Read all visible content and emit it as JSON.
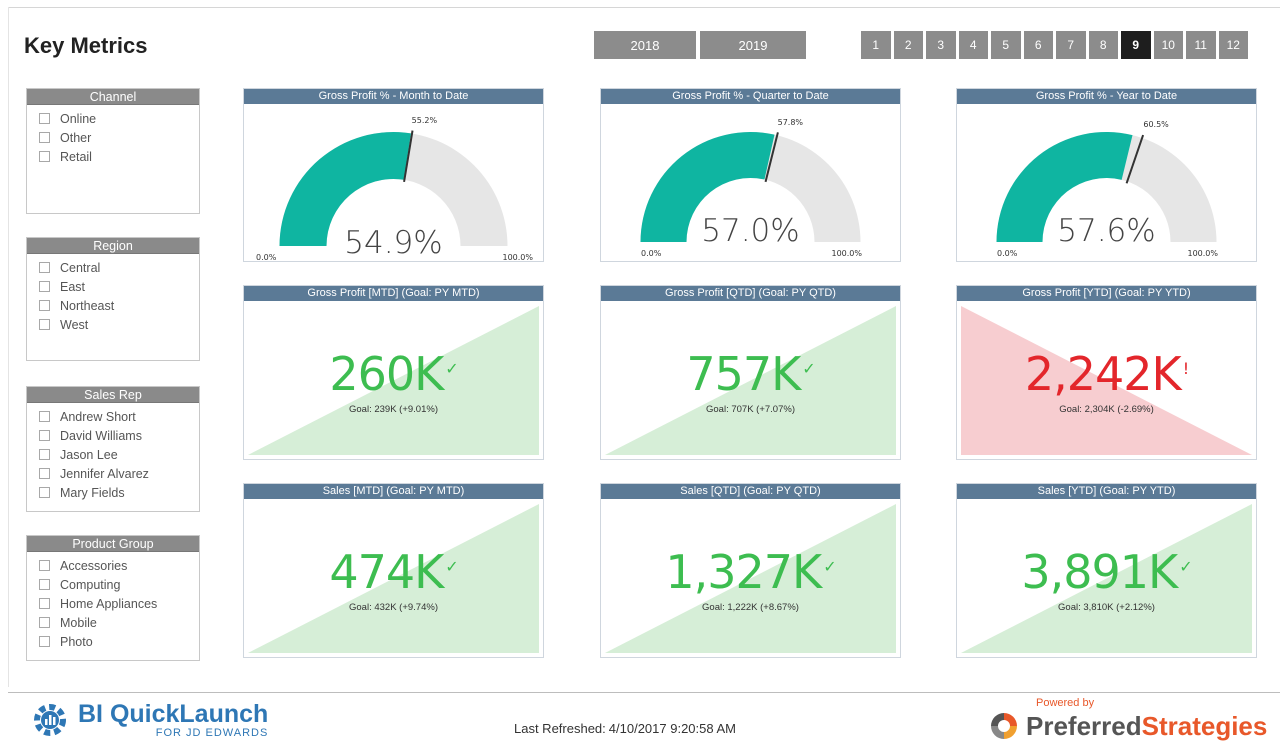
{
  "page_title": "Key Metrics",
  "years": [
    "2018",
    "2019"
  ],
  "months": [
    "1",
    "2",
    "3",
    "4",
    "5",
    "6",
    "7",
    "8",
    "9",
    "10",
    "11",
    "12"
  ],
  "selected_month": "9",
  "slicers": {
    "channel": {
      "title": "Channel",
      "items": [
        "Online",
        "Other",
        "Retail"
      ]
    },
    "region": {
      "title": "Region",
      "items": [
        "Central",
        "East",
        "Northeast",
        "West"
      ]
    },
    "sales_rep": {
      "title": "Sales Rep",
      "items": [
        "Andrew Short",
        "David Williams",
        "Jason Lee",
        "Jennifer Alvarez",
        "Mary Fields"
      ]
    },
    "product_group": {
      "title": "Product Group",
      "items": [
        "Accessories",
        "Computing",
        "Home Appliances",
        "Mobile",
        "Photo"
      ]
    }
  },
  "gauges": [
    {
      "title": "Gross Profit % - Month to Date",
      "value": "54.9%",
      "value_pct": 54.9,
      "target": "55.2%",
      "target_pct": 55.2,
      "min": "0.0%",
      "max": "100.0%"
    },
    {
      "title": "Gross Profit % - Quarter to Date",
      "value": "57.0%",
      "value_pct": 57.0,
      "target": "57.8%",
      "target_pct": 57.8,
      "min": "0.0%",
      "max": "100.0%"
    },
    {
      "title": "Gross Profit % - Year to Date",
      "value": "57.6%",
      "value_pct": 57.6,
      "target": "60.5%",
      "target_pct": 60.5,
      "min": "0.0%",
      "max": "100.0%"
    }
  ],
  "kpis": [
    {
      "title": "Gross Profit [MTD] (Goal: PY MTD)",
      "value": "260K",
      "goal": "Goal: 239K (+9.01%)",
      "status": "good",
      "indicator": "✓"
    },
    {
      "title": "Gross Profit [QTD] (Goal: PY QTD)",
      "value": "757K",
      "goal": "Goal: 707K (+7.07%)",
      "status": "good",
      "indicator": "✓"
    },
    {
      "title": "Gross Profit [YTD] (Goal: PY YTD)",
      "value": "2,242K",
      "goal": "Goal: 2,304K (-2.69%)",
      "status": "bad",
      "indicator": "!"
    },
    {
      "title": "Sales [MTD] (Goal: PY MTD)",
      "value": "474K",
      "goal": "Goal: 432K (+9.74%)",
      "status": "good",
      "indicator": "✓"
    },
    {
      "title": "Sales [QTD] (Goal: PY QTD)",
      "value": "1,327K",
      "goal": "Goal: 1,222K (+8.67%)",
      "status": "good",
      "indicator": "✓"
    },
    {
      "title": "Sales [YTD] (Goal: PY YTD)",
      "value": "3,891K",
      "goal": "Goal: 3,810K (+2.12%)",
      "status": "good",
      "indicator": "✓"
    }
  ],
  "colors": {
    "gauge_fill": "#0fb5a1",
    "gauge_track": "#e6e6e6",
    "tile_header": "#5b7a96",
    "good_fill": "#d6eed7",
    "bad_fill": "#f7cdd0",
    "good_text": "#3dbd50",
    "bad_text": "#e3262b"
  },
  "footer": {
    "logo_main": "BI QuickLaunch",
    "logo_sub": "FOR JD EDWARDS",
    "refreshed_label": "Last Refreshed:",
    "refreshed_value": "4/10/2017 9:20:58 AM",
    "powered_by": "Powered by",
    "brand_part1": "Preferred",
    "brand_part2": "Strategies"
  }
}
